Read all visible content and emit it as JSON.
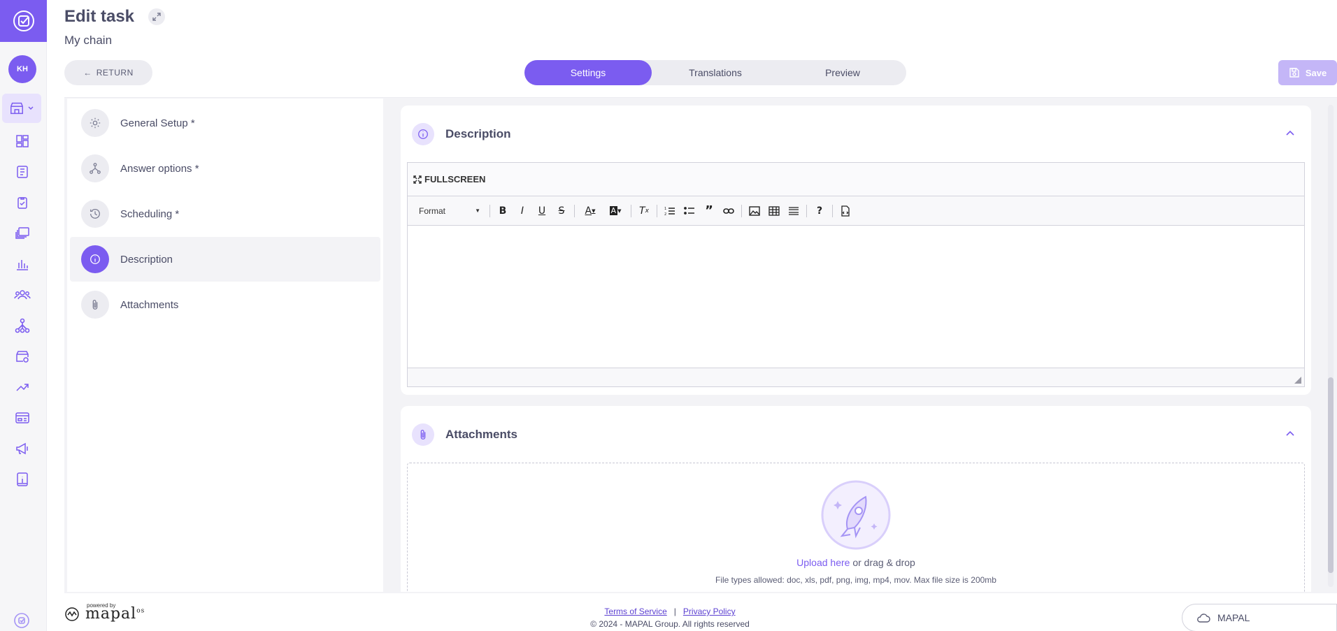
{
  "header": {
    "title": "Edit task",
    "subtitle": "My chain",
    "return_label": "RETURN",
    "save_label": "Save"
  },
  "user": {
    "initials": "KH"
  },
  "tabs": [
    {
      "label": "Settings",
      "active": true
    },
    {
      "label": "Translations",
      "active": false
    },
    {
      "label": "Preview",
      "active": false
    }
  ],
  "steps": [
    {
      "label": "General Setup *",
      "icon": "gear-icon"
    },
    {
      "label": "Answer options *",
      "icon": "branches-icon"
    },
    {
      "label": "Scheduling *",
      "icon": "history-icon"
    },
    {
      "label": "Description",
      "icon": "info-icon",
      "active": true
    },
    {
      "label": "Attachments",
      "icon": "paperclip-icon"
    }
  ],
  "description": {
    "title": "Description",
    "fullscreen_label": "FULLSCREEN",
    "format_label": "Format"
  },
  "attachments": {
    "title": "Attachments",
    "upload_link": "Upload here",
    "upload_rest": " or drag & drop",
    "allowed": "File types allowed: doc, xls, pdf, png, img, mp4, mov. Max file size is 200mb"
  },
  "footer": {
    "powered_by": "powered by",
    "brand": "mapal",
    "brand_sup": "os",
    "terms": "Terms of Service",
    "separator": "|",
    "privacy": "Privacy Policy",
    "copyright": "© 2024 - MAPAL Group. All rights reserved",
    "tenant": "MAPAL"
  },
  "colors": {
    "accent": "#7b5cf0",
    "accent_soft": "#e8e2fd",
    "save_disabled": "#c4b6f7"
  }
}
